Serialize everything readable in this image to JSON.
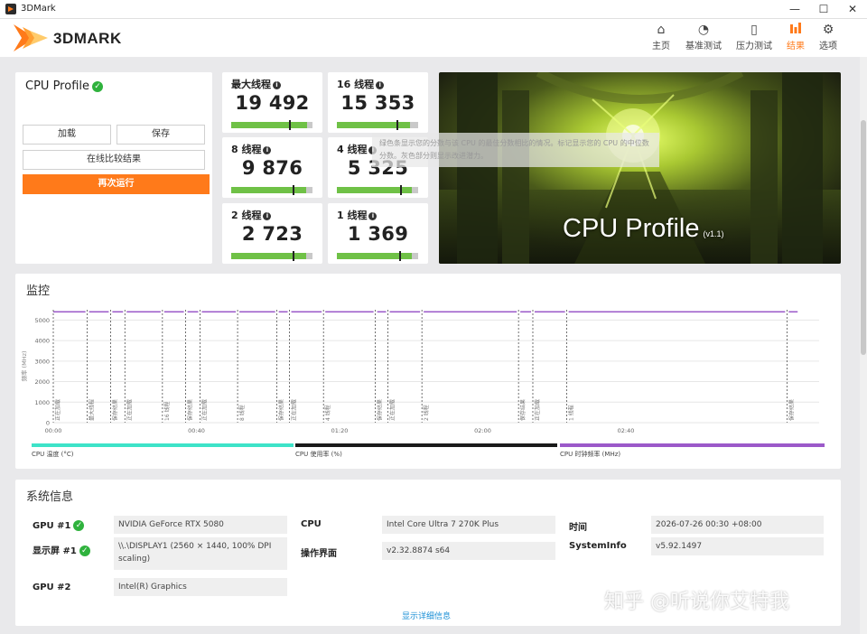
{
  "window": {
    "title": "3DMark"
  },
  "brand": {
    "logo_text": "3DMARK",
    "accent_color": "#ff7a1a"
  },
  "nav": [
    {
      "label": "主页",
      "icon": "home-icon"
    },
    {
      "label": "基准测试",
      "icon": "gauge-icon"
    },
    {
      "label": "压力测试",
      "icon": "stress-chart-icon"
    },
    {
      "label": "结果",
      "icon": "results-bars-icon",
      "active": true
    },
    {
      "label": "选项",
      "icon": "gear-icon"
    }
  ],
  "profile": {
    "title": "CPU Profile",
    "buttons": {
      "load": "加载",
      "save": "保存",
      "compare": "在线比较结果",
      "rerun": "再次运行"
    }
  },
  "scores": [
    {
      "label": "最大线程",
      "value": "19 492",
      "fill": 0.93,
      "marker": 0.71
    },
    {
      "label": "16 线程",
      "value": "15 353",
      "fill": 0.9,
      "marker": 0.73
    },
    {
      "label": "8 线程",
      "value": "9 876",
      "fill": 0.92,
      "marker": 0.75
    },
    {
      "label": "4 线程",
      "value": "5 325",
      "fill": 0.92,
      "marker": 0.78
    },
    {
      "label": "2 线程",
      "value": "2 723",
      "fill": 0.92,
      "marker": 0.76
    },
    {
      "label": "1 线程",
      "value": "1 369",
      "fill": 0.92,
      "marker": 0.77
    }
  ],
  "tooltip": {
    "text": "绿色条显示您的分数与该 CPU 的最佳分数相比的情况。标记显示您的 CPU 的中位数分数。灰色部分则显示改进潜力。"
  },
  "hero": {
    "title": "CPU Profile",
    "version": "(v1.1)"
  },
  "monitor": {
    "title": "监控",
    "ylabel": "频率 (MHz)",
    "legend": [
      {
        "label": "CPU 温度 (°C)",
        "color": "#3ee3c8"
      },
      {
        "label": "CPU 使用率 (%)",
        "color": "#1a1a1a"
      },
      {
        "label": "CPU 时钟频率 (MHz)",
        "color": "#9b59c9"
      }
    ]
  },
  "chart_data": {
    "type": "line",
    "ylabel": "频率 (MHz)",
    "ylim": [
      0,
      5500
    ],
    "yticks": [
      0,
      1000,
      2000,
      3000,
      4000,
      5000
    ],
    "xticks": [
      "00:00",
      "00:40",
      "01:20",
      "02:00",
      "02:40"
    ],
    "xlim_seconds": [
      0,
      214
    ],
    "series": [
      {
        "name": "CPU 时钟频率 (MHz)",
        "approx_value": 5400,
        "color": "#9b59c9"
      }
    ],
    "markers": [
      {
        "t": 0,
        "label": "正在加载"
      },
      {
        "t": 9.5,
        "label": "最大线程"
      },
      {
        "t": 16,
        "label": "保存结果"
      },
      {
        "t": 20,
        "label": "正在加载"
      },
      {
        "t": 30.5,
        "label": "16 线程"
      },
      {
        "t": 37,
        "label": "保存结果"
      },
      {
        "t": 41,
        "label": "正在加载"
      },
      {
        "t": 51.5,
        "label": "8 线程"
      },
      {
        "t": 62.5,
        "label": "保存结果"
      },
      {
        "t": 66,
        "label": "正在加载"
      },
      {
        "t": 75.5,
        "label": "4 线程"
      },
      {
        "t": 90,
        "label": "保存结果"
      },
      {
        "t": 93.5,
        "label": "正在加载"
      },
      {
        "t": 103,
        "label": "2 线程"
      },
      {
        "t": 130,
        "label": "保存结果"
      },
      {
        "t": 134,
        "label": "正在加载"
      },
      {
        "t": 143.5,
        "label": "1 线程"
      },
      {
        "t": 205,
        "label": "保存结果"
      }
    ]
  },
  "sysinfo": {
    "title": "系统信息",
    "col1": [
      {
        "label": "GPU #1",
        "value": "NVIDIA GeForce RTX 5080",
        "check": true
      },
      {
        "label": "显示屏 #1",
        "value": "\\\\.\\DISPLAY1 (2560 × 1440, 100% DPI scaling)",
        "check": true
      },
      {
        "label": "GPU #2",
        "value": "Intel(R) Graphics",
        "check": false
      }
    ],
    "col2": [
      {
        "label": "CPU",
        "value": "Intel Core Ultra 7 270K Plus"
      },
      {
        "label": "操作界面",
        "value": "v2.32.8874 s64"
      }
    ],
    "col3": [
      {
        "label": "时间",
        "value": "2026-07-26 00:30 +08:00"
      },
      {
        "label": "SystemInfo",
        "value": "v5.92.1497"
      }
    ],
    "details_link": "显示详细信息"
  },
  "watermark": "知乎 @听说你艾特我"
}
